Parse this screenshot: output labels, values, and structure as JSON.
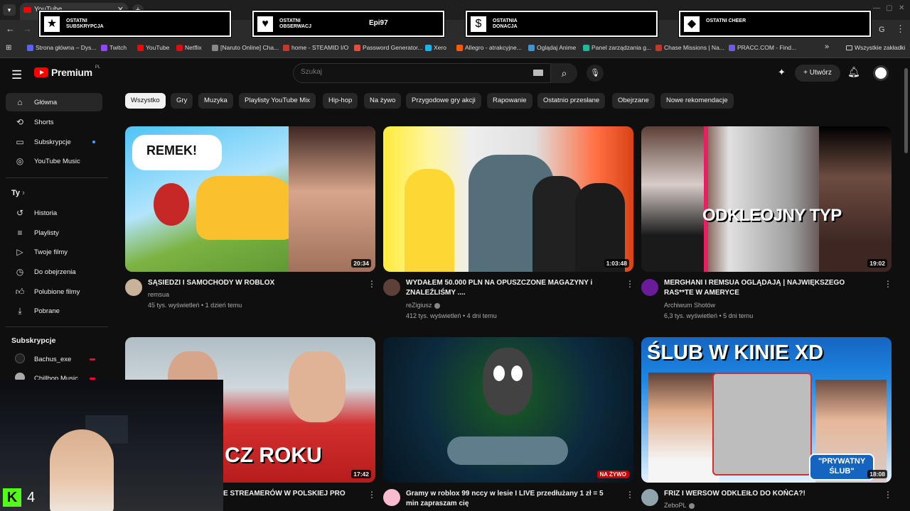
{
  "browser": {
    "tab_title": "YouTube",
    "bookmarks": [
      {
        "label": "Strona główna – Dys...",
        "color": "#5865f2"
      },
      {
        "label": "Twitch",
        "color": "#9146ff"
      },
      {
        "label": "YouTube",
        "color": "#ff0000"
      },
      {
        "label": "Netflix",
        "color": "#e50914"
      },
      {
        "label": "[Naruto Online] Cha...",
        "color": "#888888"
      },
      {
        "label": "home - STEAMID I/O",
        "color": "#c0392b"
      },
      {
        "label": "Password Generator...",
        "color": "#e74c3c"
      },
      {
        "label": "Xero",
        "color": "#13b5ea"
      },
      {
        "label": "Allegro - atrakcyjne...",
        "color": "#ff5a00"
      },
      {
        "label": "Oglądaj Anime",
        "color": "#3498db"
      },
      {
        "label": "Panel zarządzania g...",
        "color": "#1abc9c"
      },
      {
        "label": "Chase Missions | Na...",
        "color": "#c0392b"
      },
      {
        "label": "PRACC.COM - Find...",
        "color": "#6c5ce7"
      }
    ],
    "all_bookmarks": "Wszystkie zakładki"
  },
  "overlay": {
    "widgets": [
      {
        "label": "OSTATNI SUBSKRYPCJA",
        "value": ""
      },
      {
        "label": "OSTATNI OBSERWACJ",
        "value": "Epi97"
      },
      {
        "label": "OSTATNIA DONACJA",
        "value": ""
      },
      {
        "label": "OSTATNI CHEER",
        "value": ""
      }
    ],
    "kick_count": "4"
  },
  "header": {
    "logo": "Premium",
    "region": "PL",
    "search_placeholder": "Szukaj",
    "create_label": "Utwórz"
  },
  "sidebar": {
    "main": [
      {
        "label": "Główna"
      },
      {
        "label": "Shorts"
      },
      {
        "label": "Subskrypcje"
      },
      {
        "label": "YouTube Music"
      }
    ],
    "you_heading": "Ty",
    "you": [
      {
        "label": "Historia"
      },
      {
        "label": "Playlisty"
      },
      {
        "label": "Twoje filmy"
      },
      {
        "label": "Do obejrzenia"
      },
      {
        "label": "Polubione filmy"
      },
      {
        "label": "Pobrane"
      }
    ],
    "subs_heading": "Subskrypcje",
    "subs": [
      {
        "label": "Bachus_exe"
      },
      {
        "label": "Chillhop Music"
      }
    ]
  },
  "chips": [
    "Wszystko",
    "Gry",
    "Muzyka",
    "Playlisty YouTube Mix",
    "Hip-hop",
    "Na żywo",
    "Przygodowe gry akcji",
    "Rapowanie",
    "Ostatnio przesłane",
    "Obejrzane",
    "Nowe rekomendacje"
  ],
  "videos": [
    {
      "title": "SĄSIEDZI I SAMOCHODY W ROBLOX",
      "channel": "remsua",
      "meta": "45 tys. wyświetleń • 1 dzień temu",
      "duration": "20:34",
      "thumb_text": "REMEK!",
      "verified": false
    },
    {
      "title": "WYDAŁEM 50.000 PLN NA OPUSZCZONE MAGAZYNY i ZNALEŹLIŚMY ....",
      "channel": "reZigiusz",
      "meta": "412 tys. wyświetleń • 4 dni temu",
      "duration": "1:03:48",
      "thumb_text": "",
      "verified": true
    },
    {
      "title": "MERGHANI I REMSUA OGLĄDAJĄ | NAJWIĘKSZEGO RAS**TE W AMERYCE",
      "channel": "Archiwum Shotów",
      "meta": "6,3 tys. wyświetleń • 5 dni temu",
      "duration": "19:02",
      "thumb_text": "ODKLEOJNY TYP",
      "verified": false
    },
    {
      "title": "E STREAMERÓW W POLSKIEJ PRO",
      "channel": "",
      "meta": "",
      "duration": "17:42",
      "thumb_text": "CZ ROKU",
      "verified": false
    },
    {
      "title": "Gramy w roblox 99 nccy w lesie I LIVE przedłużany 1 zł = 5 min zapraszam cię",
      "channel": "",
      "meta": "",
      "duration": "NA ŻYWO",
      "thumb_text": "",
      "verified": false
    },
    {
      "title": "FRIZ I WERSOW ODKLEIŁO DO KOŃCA?!",
      "channel": "ZeboPL",
      "meta": "",
      "duration": "18:08",
      "thumb_text": "ŚLUB W KINIE XD",
      "thumb_text2": "\"PRYWATNY ŚLUB\"",
      "verified": true
    }
  ]
}
